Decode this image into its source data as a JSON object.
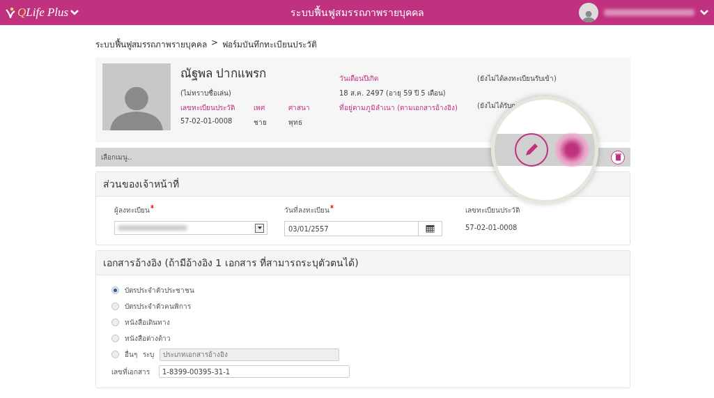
{
  "header": {
    "logo_q": "Q",
    "logo_text": "Life Plus",
    "title": "ระบบฟื้นฟูสมรรถภาพรายบุคคล"
  },
  "breadcrumb": [
    {
      "label": "ระบบฟื้นฟูสมรรถภาพรายบุคคล"
    },
    {
      "label": "ฟอร์มบันทึกทะเบียนประวัติ"
    }
  ],
  "breadcrumb_separator": ">",
  "profile": {
    "name": "ณัฐพล ปากแพรก",
    "nickname": "(ไม่ทราบชื่อเล่น)",
    "fields": [
      {
        "label": "เลขทะเบียนประวัติ",
        "value": "57-02-01-0008"
      },
      {
        "label": "เพศ",
        "value": "ชาย"
      },
      {
        "label": "ศาสนา",
        "value": "พุทธ"
      }
    ],
    "birth_label": "วันเดือนปีเกิด",
    "birth_value": "18 ส.ค. 2497 (อายุ 59 ปี 5 เดือน)",
    "address_label": "ที่อยู่ตามภูมิลำเนา (ตามเอกสารอ้างอิง)",
    "statuses": [
      "(ยังไม่ได้ลงทะเบียนรับเข้า)",
      "(ยังไม่ได้รับก"
    ]
  },
  "menu_bar": {
    "placeholder": "เลือกเมนู.."
  },
  "officer_section": {
    "title": "ส่วนของเจ้าหน้าที่",
    "fields": [
      {
        "kind": "select",
        "label": "ผู้ลงทะเบียน",
        "required": true
      },
      {
        "kind": "date",
        "label": "วันที่ลงทะเบียน",
        "required": true,
        "value": "03/01/2557"
      },
      {
        "kind": "text",
        "label": "เลขทะเบียนประวัติ",
        "required": false,
        "value": "57-02-01-0008"
      }
    ]
  },
  "document_section": {
    "title": "เอกสารอ้างอิง (ถ้ามีอ้างอิง 1 เอกสาร ที่สามารถระบุตัวตนได้)",
    "options": [
      {
        "label": "บัตรประจำตัวประชาชน",
        "selected": true
      },
      {
        "label": "บัตรประจำตัวคนพิการ",
        "selected": false
      },
      {
        "label": "หนังสือเดินทาง",
        "selected": false
      },
      {
        "label": "หนังสือต่างด้าว",
        "selected": false
      },
      {
        "label": "อื่นๆ",
        "selected": false,
        "specify_label": "ระบุ",
        "specify_placeholder": "ประเภทเอกสารอ้างอิง"
      }
    ],
    "doc_number_label": "เลขที่เอกสาร",
    "doc_number": "1-8399-00395-31-1"
  }
}
